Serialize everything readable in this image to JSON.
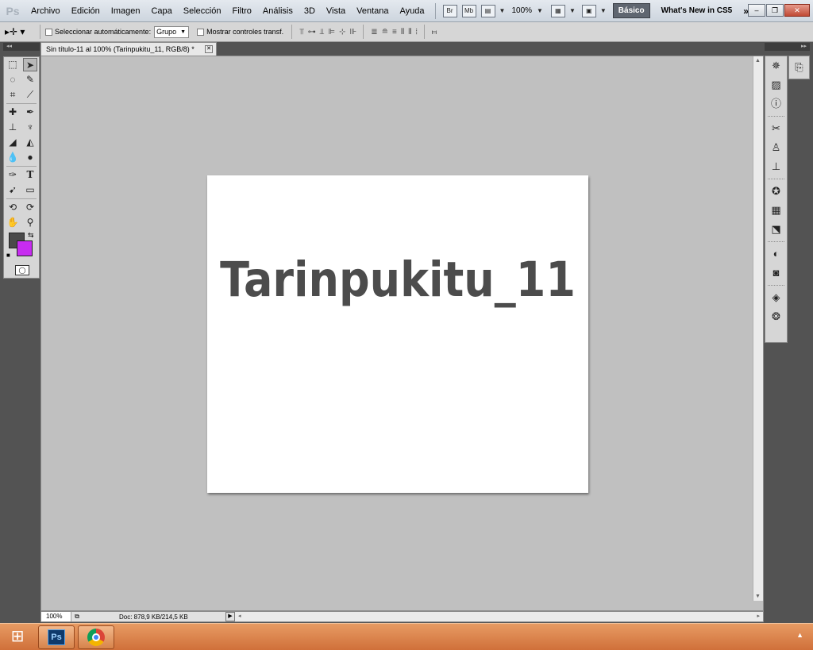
{
  "app": {
    "logo": "Ps"
  },
  "menu": {
    "items": [
      "Archivo",
      "Edición",
      "Imagen",
      "Capa",
      "Selección",
      "Filtro",
      "Análisis",
      "3D",
      "Vista",
      "Ventana",
      "Ayuda"
    ],
    "bridge_label": "Br",
    "minibridge_label": "Mb",
    "zoom": "100%",
    "workspace_active": "Básico",
    "workspace_other": "What's New in CS5",
    "more": "»"
  },
  "options": {
    "auto_select_label": "Seleccionar automáticamente:",
    "auto_select_value": "Grupo",
    "show_transform_label": "Mostrar controles transf."
  },
  "document": {
    "tab_title": "Sin título-11 al 100% (Tarinpukitu_11, RGB/8) *",
    "canvas_text": "Tarinpukitu_11",
    "foreground_color": "#4a4a4a",
    "background_color": "#c72cf0"
  },
  "status": {
    "zoom": "100%",
    "doc_info": "Doc: 878,9 KB/214,5 KB"
  },
  "taskbar": {
    "ps_label": "Ps"
  }
}
